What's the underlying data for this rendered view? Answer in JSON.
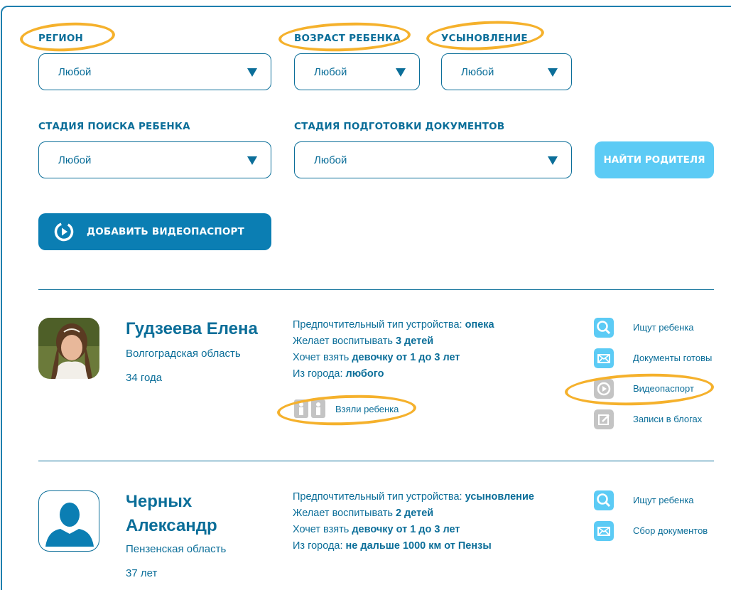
{
  "filters": {
    "region": {
      "label": "РЕГИОН",
      "value": "Любой"
    },
    "child_age": {
      "label": "ВОЗРАСТ РЕБЕНКА",
      "value": "Любой"
    },
    "adoption": {
      "label": "УСЫНОВЛЕНИЕ",
      "value": "Любой"
    },
    "search_stage": {
      "label": "СТАДИЯ ПОИСКА РЕБЕНКА",
      "value": "Любой"
    },
    "docs_stage": {
      "label": "СТАДИЯ ПОДГОТОВКИ ДОКУМЕНТОВ",
      "value": "Любой"
    },
    "find_button": "НАЙТИ РОДИТЕЛЯ"
  },
  "add_video_button": "ДОБАВИТЬ ВИДЕОПАСПОРТ",
  "parents": [
    {
      "name": "Гудзеева Елена",
      "region": "Волгоградская область",
      "age": "34 года",
      "info": {
        "type_label": "Предпочтительный тип устройства: ",
        "type_value": "опека",
        "wants_label": "Желает воспитывать ",
        "wants_value": "3 детей",
        "child_label": "Хочет взять ",
        "child_value": "девочку от 1 до 3 лет",
        "city_label": "Из города: ",
        "city_value": "любого"
      },
      "took_child": "Взяли ребенка",
      "statuses": [
        "Ищут ребенка",
        "Документы готовы",
        "Видеопаспорт",
        "Записи в блогах"
      ]
    },
    {
      "name_line1": "Черных",
      "name_line2": "Александр",
      "region": "Пензенская область",
      "age": "37 лет",
      "info": {
        "type_label": "Предпочтительный тип устройства: ",
        "type_value": "усыновление",
        "wants_label": "Желает воспитывать ",
        "wants_value": "2 детей",
        "child_label": "Хочет взять ",
        "child_value": "девочку от 1 до 3 лет",
        "city_label": "Из города: ",
        "city_value": "не дальше 1000 км от Пензы"
      },
      "statuses": [
        "Ищут ребенка",
        "Сбор документов"
      ]
    }
  ],
  "colors": {
    "primary": "#0b6e99",
    "button_dark": "#0b7eb3",
    "button_light": "#5ccbf5",
    "status_active": "#5ccbf5",
    "status_inactive": "#c4c4c4",
    "highlight": "#f5b12c"
  },
  "icons": {
    "search": "search-icon",
    "envelope": "envelope-icon",
    "play": "play-circle-icon",
    "blog": "blog-edit-icon",
    "family": "family-icon",
    "person": "person-silhouette-icon",
    "dropdown": "chevron-down-icon"
  }
}
